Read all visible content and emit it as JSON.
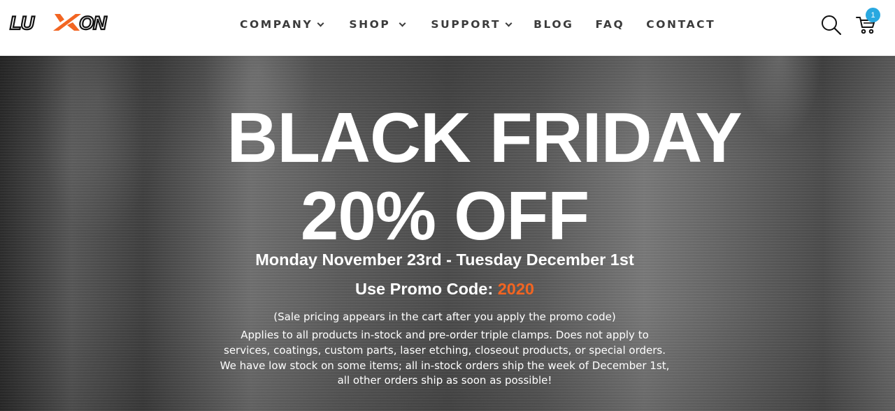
{
  "header": {
    "logo_text": "LUXON",
    "nav": [
      {
        "label": "COMPANY",
        "has_dropdown": true
      },
      {
        "label": "SHOP",
        "has_dropdown": true
      },
      {
        "label": "SUPPORT",
        "has_dropdown": true
      },
      {
        "label": "BLOG",
        "has_dropdown": false
      },
      {
        "label": "FAQ",
        "has_dropdown": false
      },
      {
        "label": "CONTACT",
        "has_dropdown": false
      }
    ],
    "search_icon": "search-icon",
    "cart_icon": "cart-icon",
    "cart_count": "1"
  },
  "hero": {
    "headline_1": "BLACK FRIDAY",
    "headline_2": "20% OFF",
    "dates": "Monday November 23rd - Tuesday December 1st",
    "promo_label": "Use Promo Code: ",
    "promo_code": "2020",
    "note": "(Sale pricing appears in the cart after you apply the promo code)",
    "details": "Applies to all products in-stock and pre-order triple clamps. Does not apply to services, coatings, custom parts, laser etching, closeout products, or special orders. We have low stock on some items; all in-stock orders ship the week of December 1st, all other orders ship as soon as possible!"
  },
  "colors": {
    "brand_orange": "#f26522",
    "badge_blue": "#29a8e0",
    "nav_text": "#3c3c3c"
  }
}
